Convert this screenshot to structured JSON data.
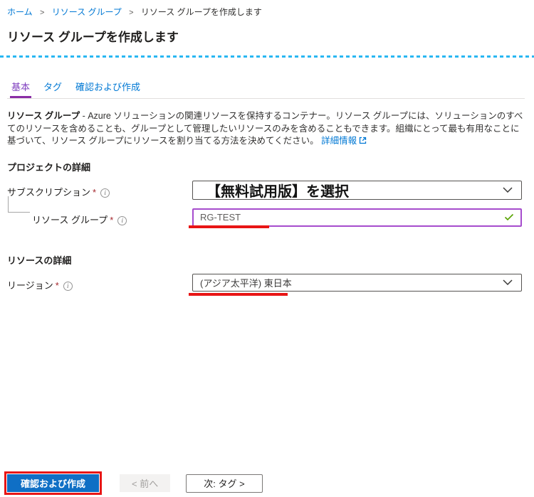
{
  "breadcrumb": {
    "separator": ">",
    "items": [
      {
        "label": "ホーム"
      },
      {
        "label": "リソース グループ"
      },
      {
        "label": "リソース グループを作成します"
      }
    ]
  },
  "page": {
    "title": "リソース グループを作成します"
  },
  "tabs": [
    {
      "label": "基本",
      "active": true
    },
    {
      "label": "タグ",
      "active": false
    },
    {
      "label": "確認および作成",
      "active": false
    }
  ],
  "description": {
    "lead": "リソース グループ",
    "body": " - Azure ソリューションの関連リソースを保持するコンテナー。リソース グループには、ソリューションのすべてのリソースを含めることも、グループとして管理したいリソースのみを含めることもできます。組織にとって最も有用なことに基づいて、リソース グループにリソースを割り当てる方法を決めてください。",
    "learn_more": "詳細情報"
  },
  "form": {
    "project": {
      "heading": "プロジェクトの詳細",
      "subscription": {
        "label": "サブスクリプション",
        "required": "*",
        "value": "【無料試用版】を選択"
      },
      "resource_group": {
        "label": "リソース グループ",
        "required": "*",
        "value": "RG-TEST"
      }
    },
    "resource": {
      "heading": "リソースの詳細",
      "region": {
        "label": "リージョン",
        "required": "*",
        "value": "(アジア太平洋) 東日本"
      }
    }
  },
  "footer": {
    "review_create": "確認および作成",
    "previous": "< 前へ",
    "next": "次: タグ >"
  },
  "colors": {
    "link_blue": "#0078d4",
    "active_tab_purple": "#8a2da5",
    "divider_cyan": "#29b7f2",
    "primary_button_blue": "#0f6fc5",
    "annotation_red": "#e81515",
    "valid_green": "#57a300",
    "focus_border_purple": "#a64ccd",
    "required_red": "#a4262c"
  }
}
